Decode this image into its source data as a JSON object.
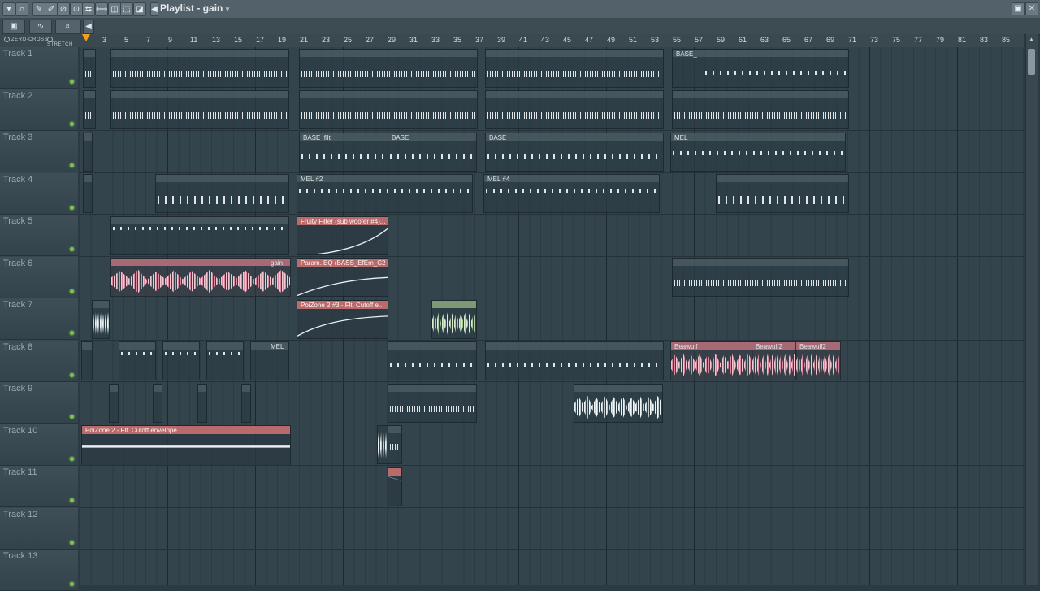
{
  "window": {
    "title": "Playlist - gain",
    "title_arrow": "▾",
    "buttons": [
      "▾",
      "∩",
      "✎",
      "✐",
      "⊘",
      "⊙",
      "⇆",
      "⟷",
      "◫",
      "⬚",
      "◪",
      "◀"
    ],
    "win_controls": [
      "▣",
      "✕"
    ]
  },
  "toolbar": {
    "nav_left": "◀",
    "tool_icons": [
      "▣",
      "∿",
      "♬"
    ]
  },
  "options": {
    "zero_cross": "ZERO-CROSS",
    "stretch": "STRETCH"
  },
  "ruler_labels": [
    "3",
    "5",
    "7",
    "9",
    "11",
    "13",
    "15",
    "17",
    "19",
    "21",
    "23",
    "25",
    "27",
    "29",
    "31",
    "33",
    "35",
    "37",
    "39",
    "41",
    "43",
    "45",
    "47",
    "49",
    "51",
    "53",
    "55",
    "57",
    "59",
    "61",
    "63",
    "65",
    "67",
    "69",
    "71",
    "73",
    "75",
    "77",
    "79",
    "81",
    "83",
    "85"
  ],
  "tracks": [
    {
      "label": "Track 1"
    },
    {
      "label": "Track 2"
    },
    {
      "label": "Track 3"
    },
    {
      "label": "Track 4"
    },
    {
      "label": "Track 5"
    },
    {
      "label": "Track 6"
    },
    {
      "label": "Track 7"
    },
    {
      "label": "Track 8"
    },
    {
      "label": "Track 9"
    },
    {
      "label": "Track 10"
    },
    {
      "label": "Track 11"
    },
    {
      "label": "Track 12"
    },
    {
      "label": "Track 13"
    }
  ],
  "clips": {
    "base_1": "BASE_",
    "base_filt": "BASE_filt",
    "base_2": "BASE_",
    "base_3": "BASE_",
    "mel": "MEL",
    "mel2": "MEL #2",
    "mel4": "MEL #4",
    "fruity": "Fruity Filter (sub woofer #4)...",
    "parameq": "Param. EQ (BASS_EfEm_C2 #...",
    "poizone3": "PoiZone 2 #3 - Flt. Cutoff e...",
    "beawulf": "Beawulf",
    "beawulf2a": "Beawulf2",
    "beawulf2b": "Beawulf2",
    "poizone_t10": "PoiZone 2 - Flt. Cutoff envelope",
    "mel_t8": "MEL",
    "gain": "gain"
  },
  "colors": {
    "automation": "#b96a6a",
    "audio_pink": "#f2c6cf",
    "audio_green": "#a8c89c",
    "led": "#7ec04a"
  }
}
